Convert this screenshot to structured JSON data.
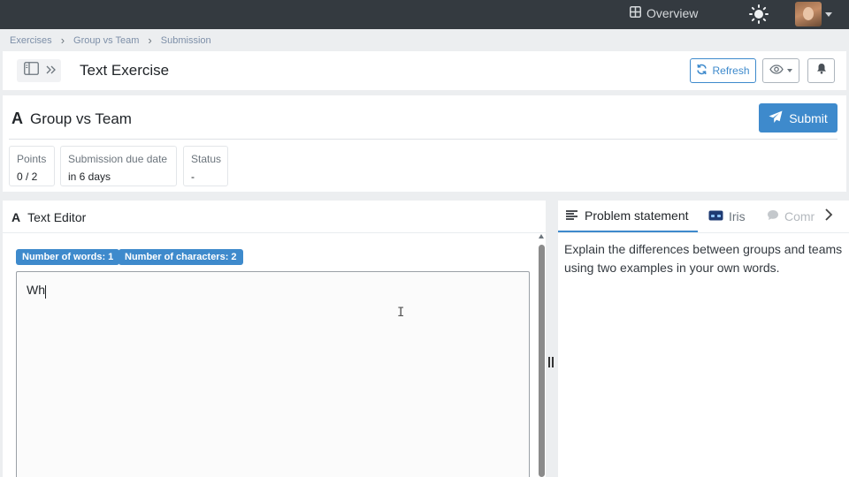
{
  "topbar": {
    "overview_label": "Overview",
    "icons": {
      "overview": "grid-icon",
      "theme": "sun-icon",
      "avatar": "user-avatar"
    }
  },
  "breadcrumb": {
    "items": [
      "Exercises",
      "Group vs Team",
      "Submission"
    ]
  },
  "header": {
    "title": "Text Exercise",
    "refresh_label": "Refresh",
    "icons": {
      "sidebar": "sidebar-panel-icon",
      "expand": "double-chevron-right-icon",
      "refresh": "refresh-icon",
      "visibility": "eye-icon",
      "notifications": "bell-icon"
    }
  },
  "exercise": {
    "title": "Group vs Team",
    "submit_label": "Submit",
    "info": [
      {
        "label": "Points",
        "value": "0 / 2"
      },
      {
        "label": "Submission due date",
        "value": "in 6 days"
      },
      {
        "label": "Status",
        "value": "-"
      }
    ]
  },
  "editor": {
    "title": "Text Editor",
    "words_badge": "Number of words: 1",
    "chars_badge": "Number of characters: 2",
    "content": "Wh"
  },
  "problem": {
    "tab_statement": "Problem statement",
    "tab_iris": "Iris",
    "tab_comm": "Communication",
    "text": "Explain the differences between groups and teams using two examples in your own words."
  },
  "colors": {
    "accent": "#3e8acc",
    "topbar": "#343a40",
    "background": "#eceef0"
  }
}
